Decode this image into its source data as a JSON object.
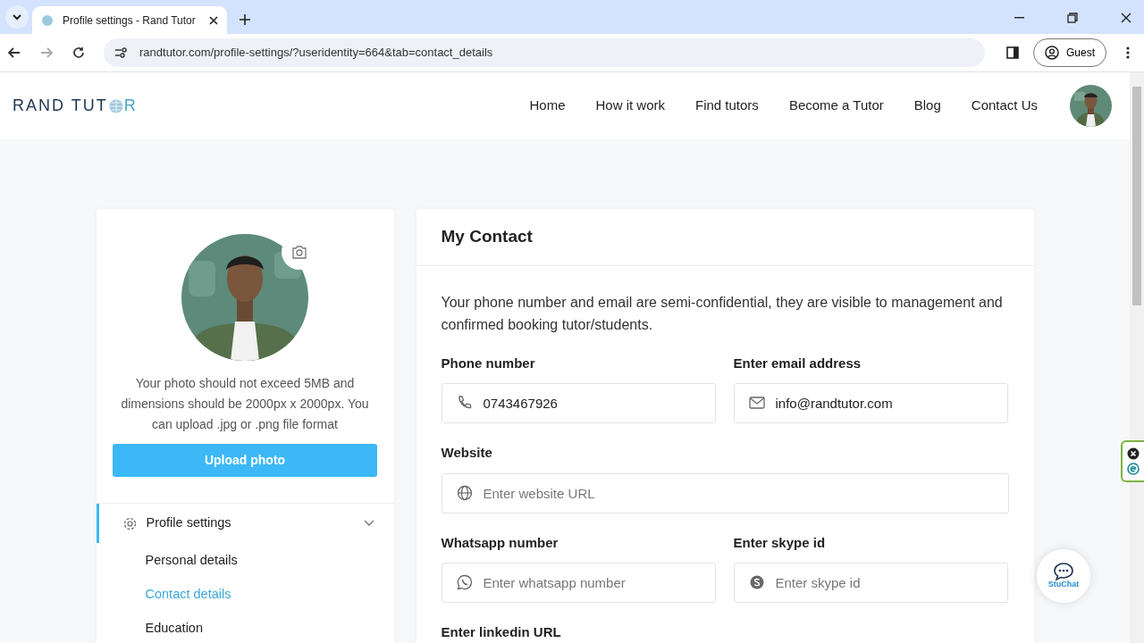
{
  "browser": {
    "tab_title": "Profile settings - Rand Tutor",
    "url": "randtutor.com/profile-settings/?useridentity=664&tab=contact_details",
    "profile_label": "Guest"
  },
  "site": {
    "logo_parts": [
      "RAND TUT",
      "R"
    ],
    "nav": [
      {
        "label": "Home"
      },
      {
        "label": "How it work"
      },
      {
        "label": "Find tutors"
      },
      {
        "label": "Become a Tutor"
      },
      {
        "label": "Blog"
      },
      {
        "label": "Contact Us"
      }
    ]
  },
  "sidebar": {
    "photo_note": "Your photo should not exceed 5MB and dimensions should be 2000px x 2000px. You can upload .jpg or .png file format",
    "upload_button": "Upload photo",
    "menu": [
      {
        "label": "Profile settings",
        "expanded": true,
        "children": [
          {
            "label": "Personal details",
            "selected": false
          },
          {
            "label": "Contact details",
            "selected": true
          },
          {
            "label": "Education",
            "selected": false
          }
        ]
      }
    ]
  },
  "contact": {
    "title": "My Contact",
    "note": "Your phone number and email are semi-confidential, they are visible to management and confirmed booking tutor/students.",
    "fields": [
      {
        "label": "Phone number",
        "kind": "phone",
        "value": "0743467926",
        "wide": false
      },
      {
        "label": "Enter email address",
        "kind": "email",
        "value": "info@randtutor.com",
        "wide": false
      },
      {
        "label": "Website",
        "kind": "website",
        "placeholder": "Enter website URL",
        "wide": true
      },
      {
        "label": "Whatsapp number",
        "kind": "whatsapp",
        "placeholder": "Enter whatsapp number",
        "wide": false
      },
      {
        "label": "Enter skype id",
        "kind": "skype",
        "placeholder": "Enter skype id",
        "wide": false
      },
      {
        "label": "Enter linkedin URL",
        "kind": "linkedin",
        "wide": true
      }
    ]
  },
  "chat_widget": {
    "label": "StuChat"
  }
}
